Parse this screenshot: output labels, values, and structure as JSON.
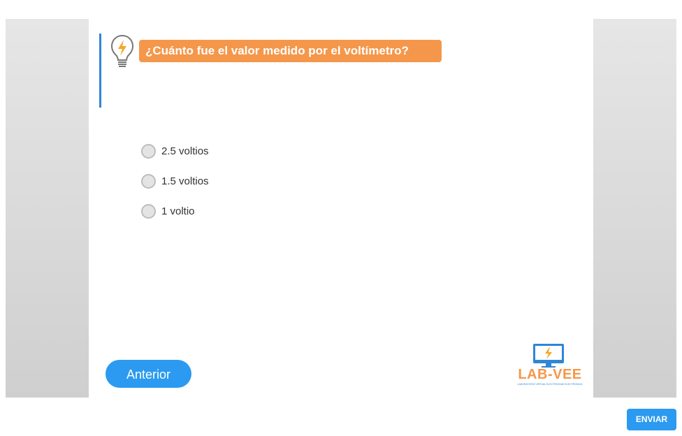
{
  "question": {
    "text": "¿Cuánto fue el valor medido por el voltímetro?",
    "icon": "lightbulb-bolt-icon"
  },
  "options": [
    {
      "label": "2.5 voltios",
      "selected": false
    },
    {
      "label": "1.5 voltios",
      "selected": false
    },
    {
      "label": "1 voltio",
      "selected": false
    }
  ],
  "navigation": {
    "previous_label": "Anterior"
  },
  "logo": {
    "name": "LAB-VEE",
    "subtitle": "LABORATORIO VIRTUAL ELECTRICIDAD ELECTRONICA",
    "icon": "monitor-bolt-icon"
  },
  "submit": {
    "label": "ENVIAR"
  },
  "colors": {
    "accent_orange": "#f5974a",
    "accent_blue": "#2b9af0",
    "bar_blue": "#2f86d6"
  }
}
